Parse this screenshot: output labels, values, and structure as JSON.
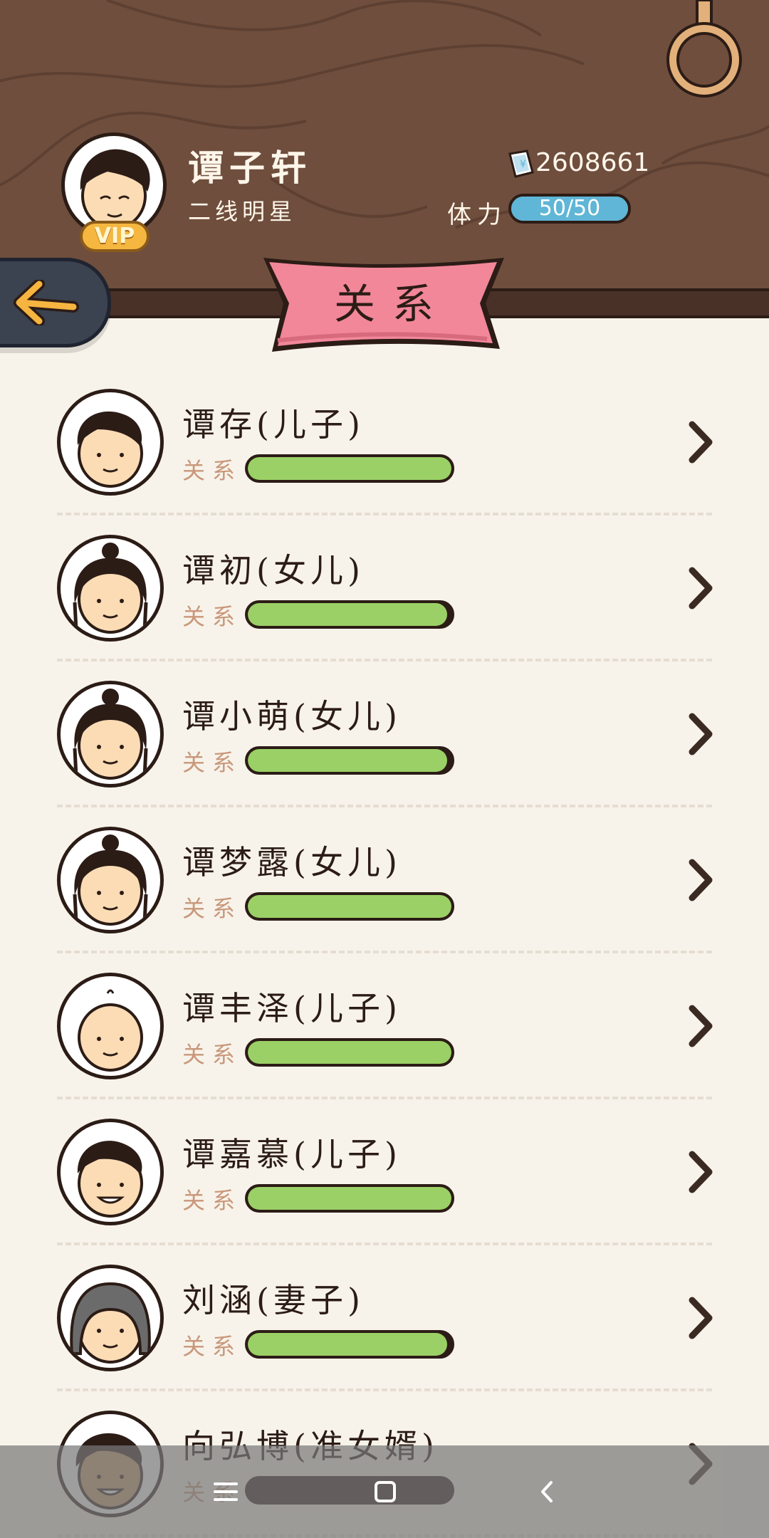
{
  "player": {
    "name": "谭子轩",
    "title": "二线明星",
    "vip_label": "VIP",
    "money": "2608661",
    "stamina_label": "体力",
    "stamina_text": "50/50",
    "stamina_fraction": 1.0
  },
  "page": {
    "banner_title": "关系"
  },
  "relationship_label": "关系",
  "members": [
    {
      "name": "谭存(儿子)",
      "relation_fraction": 1.0,
      "avatar": "boy-face-icon"
    },
    {
      "name": "谭初(女儿)",
      "relation_fraction": 0.98,
      "avatar": "girl-bun-face-icon"
    },
    {
      "name": "谭小萌(女儿)",
      "relation_fraction": 0.98,
      "avatar": "girl-bun-face-icon"
    },
    {
      "name": "谭梦露(女儿)",
      "relation_fraction": 1.0,
      "avatar": "girl-bun-face-icon"
    },
    {
      "name": "谭丰泽(儿子)",
      "relation_fraction": 1.0,
      "avatar": "baby-face-icon"
    },
    {
      "name": "谭嘉慕(儿子)",
      "relation_fraction": 1.0,
      "avatar": "boy-smile-face-icon"
    },
    {
      "name": "刘涵(妻子)",
      "relation_fraction": 0.98,
      "avatar": "woman-gray-hair-face-icon"
    },
    {
      "name": "向弘博(准女婿)",
      "relation_fraction": 0.0,
      "avatar": "man-dark-skin-face-icon"
    }
  ],
  "colors": {
    "wood": "#6f4e3d",
    "relation_green": "#9bd066",
    "stamina_blue": "#5fb6d6",
    "banner_pink": "#f2879a",
    "back_button": "#3b4250"
  },
  "nav": {
    "icons": [
      "menu-icon",
      "home-square-icon",
      "back-chevron-icon"
    ]
  }
}
